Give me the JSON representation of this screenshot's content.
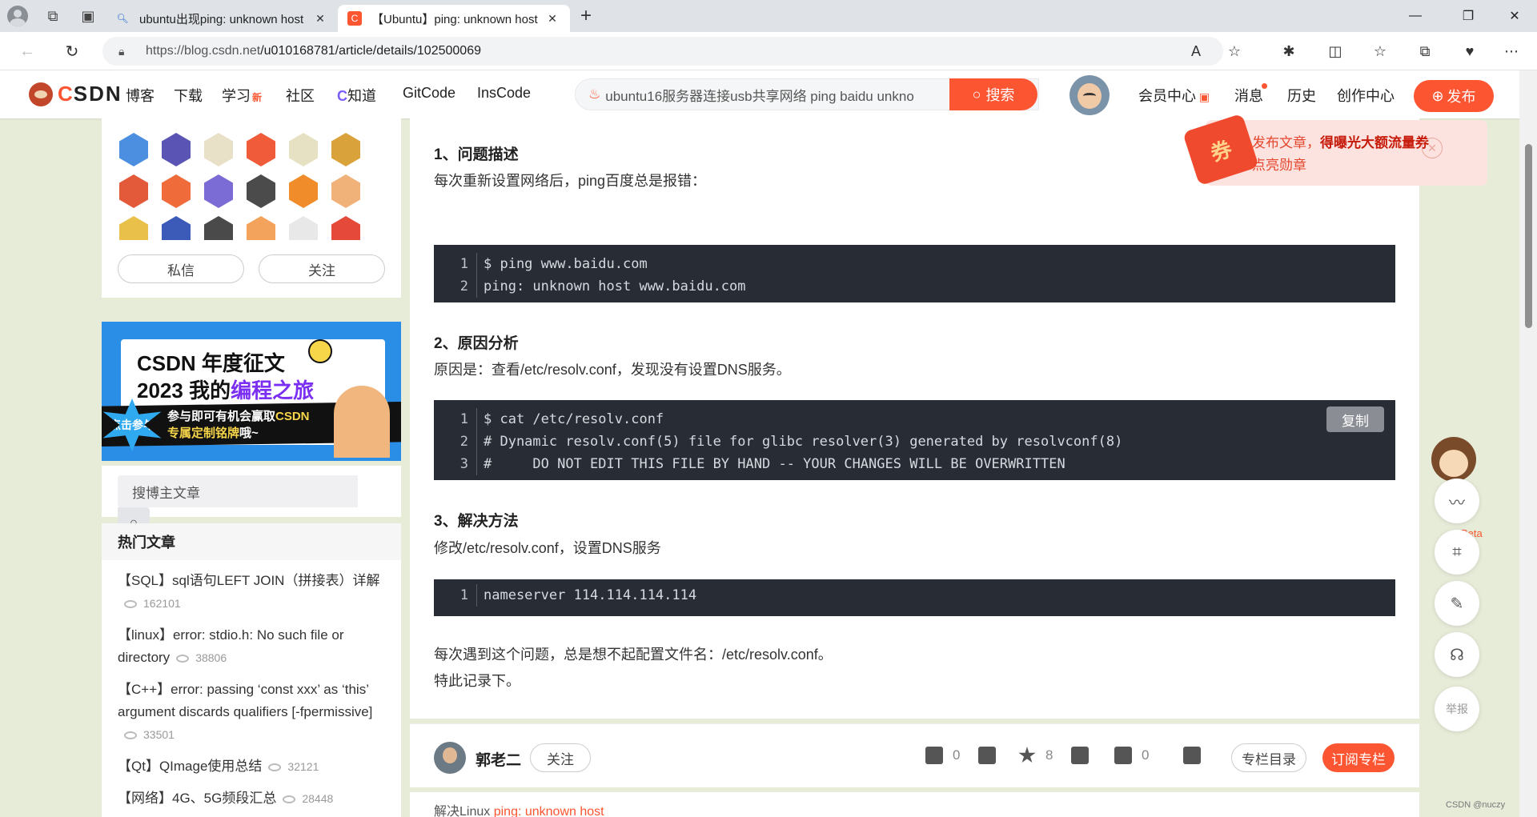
{
  "browser": {
    "tabs": [
      {
        "title": "ubuntu出现ping: unknown host",
        "favicon": "search-icon",
        "active": false
      },
      {
        "title": "【Ubuntu】ping: unknown host",
        "favicon": "csdn-c-icon",
        "active": true
      }
    ],
    "url_host": "https://blog.csdn.net",
    "url_path": "/u010168781/article/details/102500069"
  },
  "toolbar": {
    "logo": "CSDN",
    "nav": [
      "博客",
      "下载",
      "学习",
      "社区",
      "知道",
      "GitCode",
      "InsCode"
    ],
    "learn_badge": "新",
    "search_text": "ubuntu16服务器连接usb共享网络 ping baidu unkno",
    "search_button": "搜索",
    "right_nav": [
      "会员中心",
      "消息",
      "历史",
      "创作中心"
    ],
    "publish": "发布"
  },
  "left": {
    "badges": [
      {
        "color": "#4c8fe0"
      },
      {
        "color": "#5a55b5"
      },
      {
        "color": "#e9e0c8"
      },
      {
        "color": "#f05b3a"
      },
      {
        "color": "#e7e1c4"
      },
      {
        "color": "#d9a23a"
      },
      {
        "color": "#e35a3a"
      },
      {
        "color": "#f06b3a"
      },
      {
        "color": "#7b6bd4"
      },
      {
        "color": "#4b4b4b"
      },
      {
        "color": "#f08c2a"
      },
      {
        "color": "#f1b27a"
      },
      {
        "color": "#e8c04a"
      },
      {
        "color": "#3c5bb8"
      },
      {
        "color": "#4a4a4a"
      },
      {
        "color": "#f3a35c"
      },
      {
        "color": "#e8e8e8"
      },
      {
        "color": "#e4493a"
      },
      {
        "color": "#d9463a"
      }
    ],
    "message_btn": "私信",
    "follow_btn": "关注",
    "banner": {
      "line1": "CSDN 年度征文",
      "line2a": "2023 我的",
      "line2b": "编程之旅",
      "line3a": "参与即可有机会赢取",
      "line3b": "CSDN",
      "line4a": "专属定制铭牌",
      "line4b": "哦~",
      "star": "点击参与"
    },
    "blog_search_placeholder": "搜博主文章",
    "hot_title": "热门文章",
    "hot_articles": [
      {
        "title": "【SQL】sql语句LEFT JOIN（拼接表）详解",
        "views": "162101"
      },
      {
        "title": "【linux】error: stdio.h: No such file or directory",
        "views": "38806"
      },
      {
        "title": "【C++】error: passing ‘const xxx’ as ‘this’ argument discards qualifiers [-fpermissive]",
        "views": "33501"
      },
      {
        "title": "【Qt】QImage使用总结",
        "views": "32121"
      },
      {
        "title": "【网络】4G、5G频段汇总",
        "views": "28448"
      }
    ]
  },
  "article": {
    "h1": "1、问题描述",
    "p1": "每次重新设置网络后，ping百度总是报错：",
    "code1": [
      "$ ping www.baidu.com",
      "ping: unknown host www.baidu.com"
    ],
    "h2": "2、原因分析",
    "p2": "原因是：查看/etc/resolv.conf，发现没有设置DNS服务。",
    "code2": [
      "$ cat /etc/resolv.conf",
      "# Dynamic resolv.conf(5) file for glibc resolver(3) generated by resolvconf(8)",
      "#     DO NOT EDIT THIS FILE BY HAND -- YOUR CHANGES WILL BE OVERWRITTEN"
    ],
    "copy": "复制",
    "h3": "3、解决方法",
    "p3": "修改/etc/resolv.conf，设置DNS服务",
    "code3": [
      "nameserver 114.114.114.114"
    ],
    "p4": "每次遇到这个问题，总是想不起配置文件名：/etc/resolv.conf。",
    "p5": "特此记录下。"
  },
  "article_toolbar": {
    "author": "郭老二",
    "follow": "关注",
    "likes": "0",
    "collects": "8",
    "comments": "0",
    "toc": "专栏目录",
    "subscribe": "订阅专栏"
  },
  "next_article": {
    "prefix": "解决Linux",
    "highlight": "ping: unknown host"
  },
  "popup": {
    "line1a": "发布文章，",
    "line1b": "得曝光大额流量券",
    "line2": "点亮勋章",
    "ticket": "券"
  },
  "float": {
    "beta": "Beta",
    "report": "举报"
  },
  "watermark": "CSDN @nuczy"
}
